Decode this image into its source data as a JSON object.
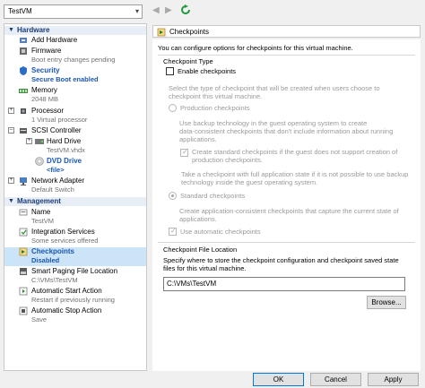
{
  "vm_selector": {
    "value": "TestVM"
  },
  "tree": {
    "hardware_header": "Hardware",
    "add_hardware": "Add Hardware",
    "firmware": {
      "name": "Firmware",
      "detail": "Boot entry changes pending"
    },
    "security": {
      "name": "Security",
      "detail": "Secure Boot enabled"
    },
    "memory": {
      "name": "Memory",
      "detail": "2048 MB"
    },
    "processor": {
      "name": "Processor",
      "detail": "1 Virtual processor"
    },
    "scsi": {
      "name": "SCSI Controller"
    },
    "hard_drive": {
      "name": "Hard Drive",
      "detail": "TestVM.vhdx"
    },
    "dvd_drive": {
      "name": "DVD Drive",
      "detail": "<file>"
    },
    "network": {
      "name": "Network Adapter",
      "detail": "Default Switch"
    },
    "management_header": "Management",
    "name": {
      "name": "Name",
      "detail": "TestVM"
    },
    "integration": {
      "name": "Integration Services",
      "detail": "Some services offered"
    },
    "checkpoints": {
      "name": "Checkpoints",
      "detail": "Disabled"
    },
    "smart_paging": {
      "name": "Smart Paging File Location",
      "detail": "C:\\VMs\\TestVM"
    },
    "auto_start": {
      "name": "Automatic Start Action",
      "detail": "Restart if previously running"
    },
    "auto_stop": {
      "name": "Automatic Stop Action",
      "detail": "Save"
    }
  },
  "pane": {
    "title": "Checkpoints",
    "intro": "You can configure options for checkpoints for this virtual machine.",
    "type_label": "Checkpoint Type",
    "enable_label": "Enable checkpoints",
    "select_line1": "Select the type of checkpoint that will be created when users choose to",
    "select_line2": "checkpoint this virtual machine.",
    "production_label": "Production checkpoints",
    "production_desc1": "Use backup technology in the guest operating system to create",
    "production_desc2": "data-consistent checkpoints that don't include information about running",
    "production_desc3": "applications.",
    "fallback_line1": "Create standard checkpoints if the guest does not support creation of",
    "fallback_line2": "production checkpoints.",
    "take_line1": "Take a checkpoint with full application state if it is not possible to use backup",
    "take_line2": "technology inside the guest operating system.",
    "standard_label": "Standard checkpoints",
    "standard_desc1": "Create application-consistent checkpoints that capture the current state of",
    "standard_desc2": "applications.",
    "auto_label": "Use automatic checkpoints",
    "location_label": "Checkpoint File Location",
    "location_desc1": "Specify where to store the checkpoint configuration and checkpoint saved state",
    "location_desc2": "files for this virtual machine.",
    "location_value": "C:\\VMs\\TestVM",
    "browse_label": "Browse..."
  },
  "buttons": {
    "ok": "OK",
    "cancel": "Cancel",
    "apply": "Apply"
  }
}
